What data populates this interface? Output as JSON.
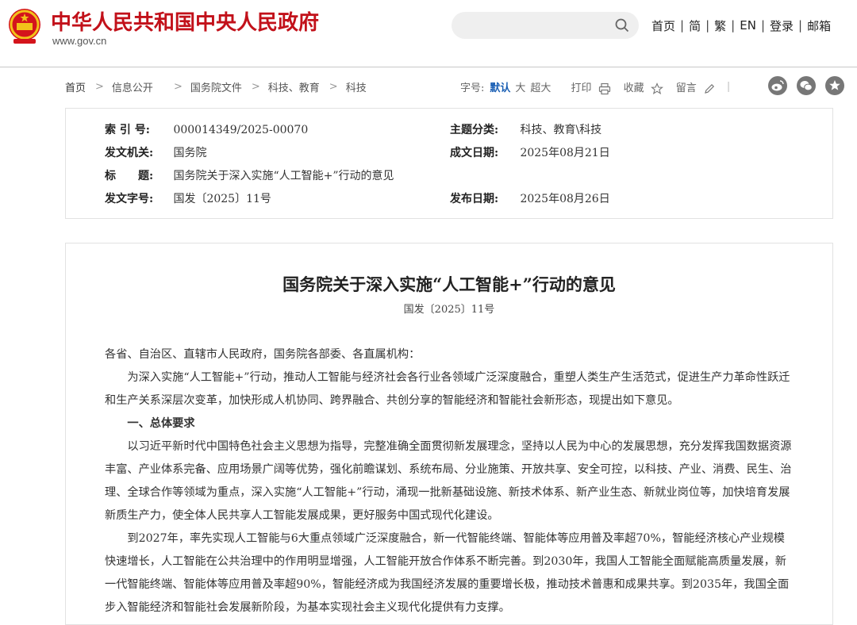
{
  "header": {
    "site_title": "中华人民共和国中央人民政府",
    "site_url": "www.gov.cn",
    "search_placeholder": "",
    "nav": [
      "首页",
      "简",
      "繁",
      "EN",
      "登录",
      "邮箱"
    ],
    "nav_separator": "|"
  },
  "breadcrumb": {
    "items": [
      "首页",
      "信息公开",
      "国务院文件",
      "科技、教育",
      "科技"
    ],
    "separator": ">"
  },
  "toolbar": {
    "font_size_label": "字号:",
    "font_sizes": [
      "默认",
      "大",
      "超大"
    ],
    "print_label": "打印",
    "favorite_label": "收藏",
    "comment_label": "留言",
    "divider": "|"
  },
  "meta": {
    "index_no_label": "索 引 号:",
    "index_no": "000014349/2025-00070",
    "topic_label": "主题分类:",
    "topic": "科技、教育\\科技",
    "issuer_label": "发文机关:",
    "issuer": "国务院",
    "written_date_label": "成文日期:",
    "written_date": "2025年08月21日",
    "title_label": "标　　题:",
    "title": "国务院关于深入实施“人工智能+”行动的意见",
    "doc_no_label": "发文字号:",
    "doc_no": "国发〔2025〕11号",
    "publish_date_label": "发布日期:",
    "publish_date": "2025年08月26日"
  },
  "article": {
    "title": "国务院关于深入实施“人工智能+”行动的意见",
    "doc_no": "国发〔2025〕11号",
    "addressee": "各省、自治区、直辖市人民政府，国务院各部委、各直属机构：",
    "para1": "为深入实施“人工智能+”行动，推动人工智能与经济社会各行业各领域广泛深度融合，重塑人类生产生活范式，促进生产力革命性跃迁和生产关系深层次变革，加快形成人机协同、跨界融合、共创分享的智能经济和智能社会新形态，现提出如下意见。",
    "heading1": "一、总体要求",
    "para2": "以习近平新时代中国特色社会主义思想为指导，完整准确全面贯彻新发展理念，坚持以人民为中心的发展思想，充分发挥我国数据资源丰富、产业体系完备、应用场景广阔等优势，强化前瞻谋划、系统布局、分业施策、开放共享、安全可控，以科技、产业、消费、民生、治理、全球合作等领域为重点，深入实施“人工智能+”行动，涌现一批新基础设施、新技术体系、新产业生态、新就业岗位等，加快培育发展新质生产力，使全体人民共享人工智能发展成果，更好服务中国式现代化建设。",
    "para3": "到2027年，率先实现人工智能与6大重点领域广泛深度融合，新一代智能终端、智能体等应用普及率超70%，智能经济核心产业规模快速增长，人工智能在公共治理中的作用明显增强，人工智能开放合作体系不断完善。到2030年，我国人工智能全面赋能高质量发展，新一代智能终端、智能体等应用普及率超90%，智能经济成为我国经济发展的重要增长极，推动技术普惠和成果共享。到2035年，我国全面步入智能经济和智能社会发展新阶段，为基本实现社会主义现代化提供有力支撑。"
  },
  "colors": {
    "brand_red": "#c2111a",
    "link_blue": "#1a5fb4",
    "border": "#e2e2e2"
  },
  "icons": [
    "national-emblem-icon",
    "search-icon",
    "printer-icon",
    "star-icon",
    "pencil-icon",
    "weibo-icon",
    "wechat-icon",
    "share-icon"
  ]
}
